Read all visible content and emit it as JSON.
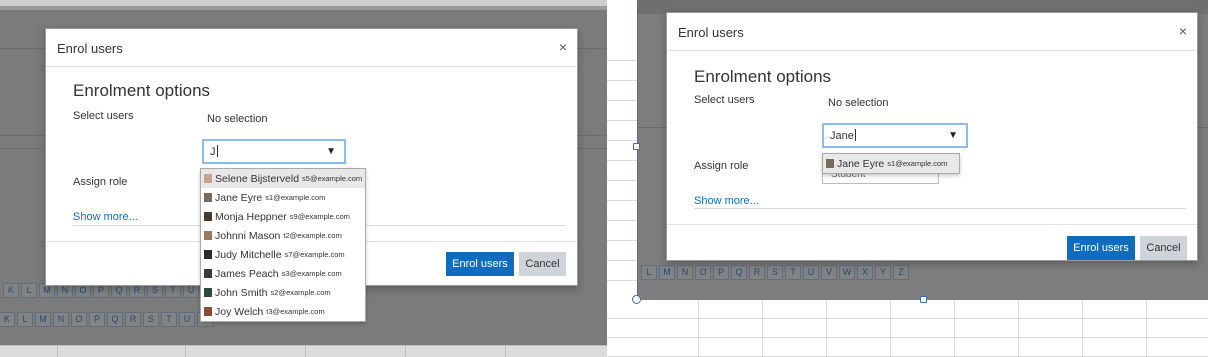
{
  "left": {
    "modal": {
      "title": "Enrol users",
      "close": "×",
      "section_title": "Enrolment options",
      "select_users_label": "Select users",
      "no_selection": "No selection",
      "search_value": "J",
      "assign_role_label": "Assign role",
      "show_more": "Show more...",
      "enrol_button": "Enrol users",
      "cancel_button": "Cancel"
    },
    "dropdown_items": [
      {
        "name": "Selene Bijsterveld",
        "email": "s5@example.com",
        "highlighted": true,
        "avatar_color": "#c9a28a"
      },
      {
        "name": "Jane Eyre",
        "email": "s1@example.com",
        "highlighted": false,
        "avatar_color": "#7a6a58"
      },
      {
        "name": "Monja Heppner",
        "email": "s9@example.com",
        "highlighted": false,
        "avatar_color": "#4a3a2a"
      },
      {
        "name": "Johnni Mason",
        "email": "t2@example.com",
        "highlighted": false,
        "avatar_color": "#9a7a5a"
      },
      {
        "name": "Judy Mitchelle",
        "email": "s7@example.com",
        "highlighted": false,
        "avatar_color": "#2a2a2a"
      },
      {
        "name": "James Peach",
        "email": "s3@example.com",
        "highlighted": false,
        "avatar_color": "#3a3a3a"
      },
      {
        "name": "John Smith",
        "email": "s2@example.com",
        "highlighted": false,
        "avatar_color": "#2f4a3a"
      },
      {
        "name": "Joy Welch",
        "email": "t3@example.com",
        "highlighted": false,
        "avatar_color": "#8a4a3a"
      }
    ],
    "letter_rows": [
      [
        "K",
        "L",
        "M",
        "N",
        "O",
        "P",
        "Q",
        "R",
        "S",
        "T",
        "U"
      ],
      [
        "K",
        "L",
        "M",
        "N",
        "O",
        "P",
        "Q",
        "R",
        "S",
        "T",
        "U",
        "V"
      ]
    ]
  },
  "right": {
    "modal": {
      "title": "Enrol users",
      "close": "×",
      "section_title": "Enrolment options",
      "select_users_label": "Select users",
      "no_selection": "No selection",
      "search_value": "Jane",
      "assign_role_label": "Assign role",
      "role_value": "Student",
      "show_more": "Show more...",
      "enrol_button": "Enrol users",
      "cancel_button": "Cancel"
    },
    "dropdown_items": [
      {
        "name": "Jane Eyre",
        "email": "s1@example.com",
        "highlighted": true,
        "avatar_color": "#7a6a58"
      }
    ],
    "letter_row": [
      "L",
      "M",
      "N",
      "O",
      "P",
      "Q",
      "R",
      "S",
      "T",
      "U",
      "V",
      "W",
      "X",
      "Y",
      "Z"
    ]
  },
  "colors": {
    "primary": "#0f6cbf",
    "secondary": "#ced4da",
    "overlay": "#7b7b7b",
    "focus_border": "#8bbcee"
  }
}
